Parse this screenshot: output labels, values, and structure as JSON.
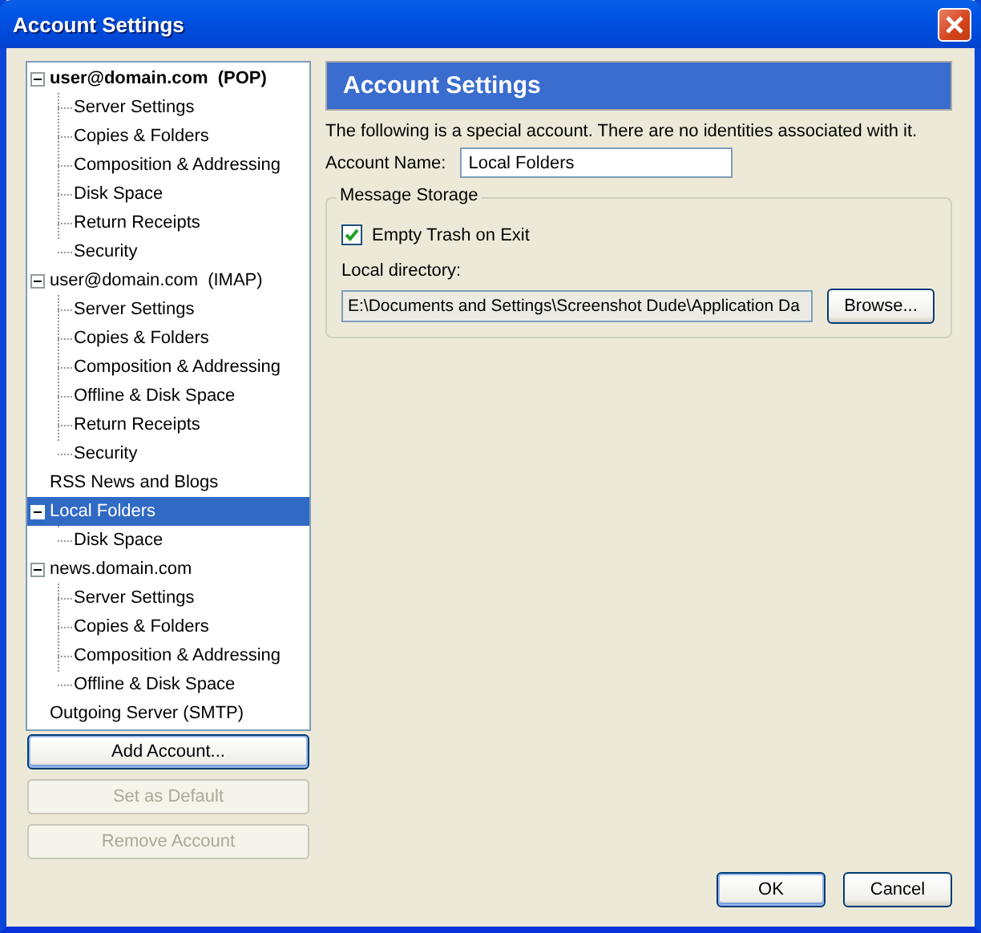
{
  "window": {
    "title": "Account Settings"
  },
  "tree": [
    {
      "label": "user@domain.com  (POP)",
      "default": true,
      "expanded": true,
      "selected": false,
      "children": [
        {
          "label": "Server Settings",
          "selected": false
        },
        {
          "label": "Copies & Folders",
          "selected": false
        },
        {
          "label": "Composition & Addressing",
          "selected": false
        },
        {
          "label": "Disk Space",
          "selected": false
        },
        {
          "label": "Return Receipts",
          "selected": false
        },
        {
          "label": "Security",
          "selected": false
        }
      ]
    },
    {
      "label": "user@domain.com  (IMAP)",
      "default": false,
      "expanded": true,
      "selected": false,
      "children": [
        {
          "label": "Server Settings",
          "selected": false
        },
        {
          "label": "Copies & Folders",
          "selected": false
        },
        {
          "label": "Composition & Addressing",
          "selected": false
        },
        {
          "label": "Offline & Disk Space",
          "selected": false
        },
        {
          "label": "Return Receipts",
          "selected": false
        },
        {
          "label": "Security",
          "selected": false
        }
      ]
    },
    {
      "label": "RSS News and Blogs",
      "default": false,
      "selected": false
    },
    {
      "label": "Local Folders",
      "default": false,
      "expanded": true,
      "selected": true,
      "children": [
        {
          "label": "Disk Space",
          "selected": false
        }
      ]
    },
    {
      "label": "news.domain.com",
      "default": false,
      "expanded": true,
      "selected": false,
      "children": [
        {
          "label": "Server Settings",
          "selected": false
        },
        {
          "label": "Copies & Folders",
          "selected": false
        },
        {
          "label": "Composition & Addressing",
          "selected": false
        },
        {
          "label": "Offline & Disk Space",
          "selected": false
        }
      ]
    },
    {
      "label": "Outgoing Server (SMTP)",
      "default": false,
      "selected": false
    }
  ],
  "tree_buttons": [
    {
      "label": "Add Account...",
      "disabled": false,
      "focused": true
    },
    {
      "label": "Set as Default",
      "disabled": true,
      "focused": false
    },
    {
      "label": "Remove Account",
      "disabled": true,
      "focused": false
    }
  ],
  "panel": {
    "header": "Account Settings",
    "note": "The following is a special account. There are no identities associated with it.",
    "account_name": {
      "label": "Account Name:",
      "value": "Local Folders"
    },
    "group": {
      "title": "Message Storage",
      "checkbox": {
        "label": "Empty Trash on Exit",
        "checked": true
      },
      "directory_label": "Local directory:",
      "directory_value": "E:\\Documents and Settings\\Screenshot Dude\\Application Da",
      "browse": "Browse..."
    }
  },
  "dialog_buttons": [
    {
      "label": "OK",
      "focused": true
    },
    {
      "label": "Cancel",
      "focused": false
    }
  ]
}
